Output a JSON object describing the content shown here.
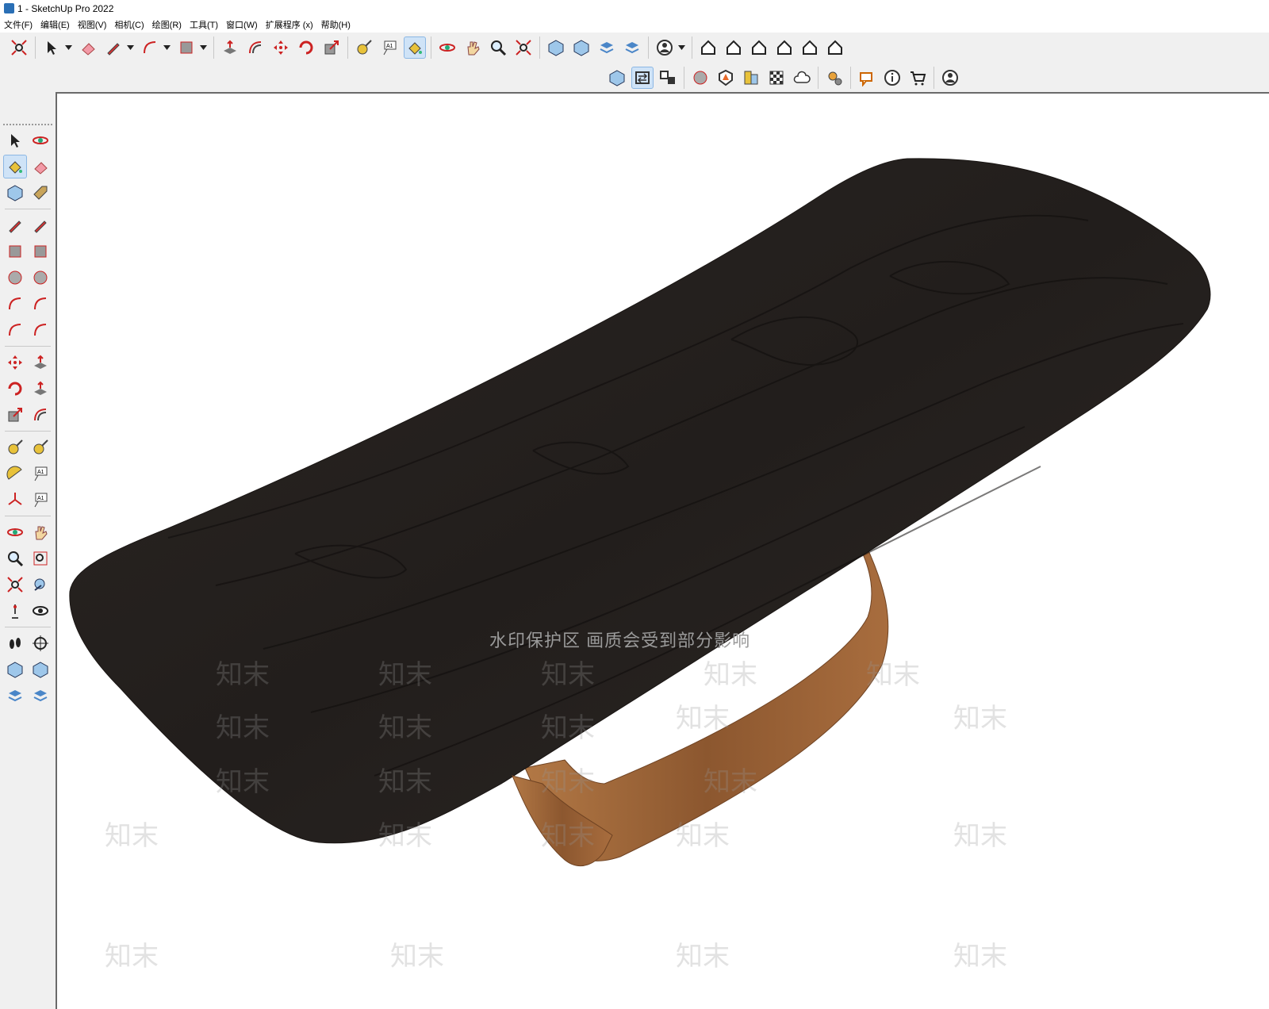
{
  "window": {
    "title": "1 - SketchUp Pro 2022",
    "icon": "sketchup-icon"
  },
  "menubar": {
    "items": [
      "文件(F)",
      "编辑(E)",
      "视图(V)",
      "相机(C)",
      "绘图(R)",
      "工具(T)",
      "窗口(W)",
      "扩展程序 (x)",
      "帮助(H)"
    ]
  },
  "toolbar": {
    "row1": [
      {
        "icon": "zoom-extents-icon"
      },
      {
        "sep": true
      },
      {
        "icon": "select-arrow-icon",
        "dropdown": true
      },
      {
        "icon": "eraser-icon"
      },
      {
        "icon": "pencil-icon",
        "dropdown": true
      },
      {
        "icon": "arc-icon",
        "dropdown": true
      },
      {
        "icon": "rectangle-icon",
        "dropdown": true
      },
      {
        "sep": true
      },
      {
        "icon": "push-pull-icon"
      },
      {
        "icon": "offset-icon"
      },
      {
        "icon": "move-icon"
      },
      {
        "icon": "rotate-icon"
      },
      {
        "icon": "scale-icon"
      },
      {
        "sep": true
      },
      {
        "icon": "tape-measure-icon"
      },
      {
        "icon": "text-label-icon"
      },
      {
        "icon": "paint-bucket-icon",
        "active": true
      },
      {
        "sep": true
      },
      {
        "icon": "orbit-icon"
      },
      {
        "icon": "pan-icon"
      },
      {
        "icon": "zoom-icon"
      },
      {
        "icon": "zoom-extents-alt-icon"
      },
      {
        "sep": true
      },
      {
        "icon": "warehouse-3d-icon"
      },
      {
        "icon": "extension-warehouse-icon"
      },
      {
        "icon": "layout-icon"
      },
      {
        "icon": "extension-manager-icon"
      },
      {
        "sep": true
      },
      {
        "icon": "user-account-icon",
        "dropdown": true
      },
      {
        "sep": true
      },
      {
        "icon": "iso-view-icon"
      },
      {
        "icon": "front-view-icon"
      },
      {
        "icon": "top-house-icon"
      },
      {
        "icon": "right-view-icon"
      },
      {
        "icon": "back-view-icon"
      },
      {
        "icon": "left-view-icon"
      }
    ],
    "row2": [
      {
        "icon": "sandbox-icon"
      },
      {
        "icon": "swap-icon",
        "active": true
      },
      {
        "icon": "scene-icon"
      },
      {
        "sep": true
      },
      {
        "icon": "add-circle-icon"
      },
      {
        "icon": "solid-tools-icon"
      },
      {
        "icon": "styles-icon"
      },
      {
        "icon": "checker-icon"
      },
      {
        "icon": "cloud-upload-icon"
      },
      {
        "sep": true
      },
      {
        "icon": "settings-icon"
      },
      {
        "sep": true
      },
      {
        "icon": "message-icon"
      },
      {
        "icon": "info-icon"
      },
      {
        "icon": "cart-icon"
      },
      {
        "sep": true
      },
      {
        "icon": "profile-icon"
      }
    ]
  },
  "left_toolbar": {
    "rows": [
      [
        "select-icon",
        "orbit-small-icon"
      ],
      [
        "paint-bucket-icon",
        "eraser-icon"
      ],
      [
        "component-icon",
        "tag-icon"
      ],
      [
        "pencil-icon",
        "freehand-icon"
      ],
      [
        "rectangle-icon",
        "rotated-rectangle-icon"
      ],
      [
        "circle-icon",
        "polygon-icon"
      ],
      [
        "arc-icon",
        "two-point-arc-icon"
      ],
      [
        "three-point-arc-icon",
        "pie-icon"
      ],
      [
        "move-icon",
        "push-pull-icon"
      ],
      [
        "rotate-icon",
        "follow-me-icon"
      ],
      [
        "scale-icon",
        "offset-icon"
      ],
      [
        "tape-measure-icon",
        "dimension-icon"
      ],
      [
        "protractor-icon",
        "text-label-icon"
      ],
      [
        "axes-icon",
        "3d-text-icon"
      ],
      [
        "orbit-icon",
        "pan-icon"
      ],
      [
        "zoom-icon",
        "zoom-window-icon"
      ],
      [
        "zoom-extents-icon",
        "previous-view-icon"
      ],
      [
        "position-camera-icon",
        "look-around-icon"
      ],
      [
        "walk-icon",
        "section-plane-icon"
      ],
      [
        "warehouse-3d-icon",
        "extension-warehouse-icon"
      ],
      [
        "layout-icon",
        "extension-manager-icon"
      ]
    ]
  },
  "viewport": {
    "watermark_title": "水印保护区  画质会受到部分影响",
    "watermark_mark": "知末",
    "table_top_color": "#2a2522",
    "table_base_color": "#9b6336"
  }
}
